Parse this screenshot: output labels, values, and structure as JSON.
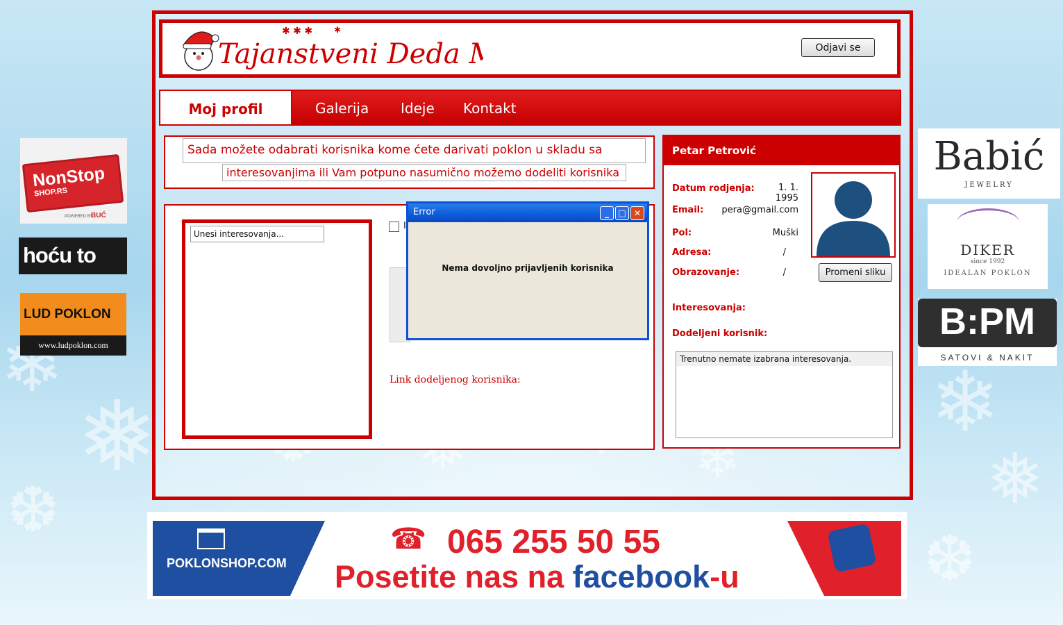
{
  "header": {
    "title": "Tajanstveni Deda Mraz",
    "logout_label": "Odjavi se"
  },
  "nav": {
    "items": [
      {
        "label": "Moj profil"
      },
      {
        "label": "Galerija"
      },
      {
        "label": "Ideje"
      },
      {
        "label": "Kontakt"
      }
    ]
  },
  "info": {
    "line1": "Sada možete odabrati korisnika kome ćete darivati poklon u skladu sa",
    "line2": "interesovanjima ili Vam potpuno nasumično možemo dodeliti korisnika"
  },
  "interests": {
    "input_value": "Unesi interesovanja...",
    "checkbox_label": "I",
    "link_label": "Link dodeljenog korisnika:"
  },
  "dialog": {
    "title": "Error",
    "message": "Nema dovoljno prijavljenih korisnika"
  },
  "profile": {
    "name": "Petar Petrović",
    "fields": [
      {
        "label": "Datum rodjenja:",
        "value": "1. 1. 1995"
      },
      {
        "label": "Email:",
        "value": "pera@gmail.com"
      },
      {
        "label": "Pol:",
        "value": "Muški"
      },
      {
        "label": "Adresa:",
        "value": "/"
      },
      {
        "label": "Obrazovanje:",
        "value": "/"
      }
    ],
    "change_photo_label": "Promeni sliku",
    "interests_label": "Interesovanja:",
    "assigned_label": "Dodeljeni korisnik:",
    "interests_list_text": "Trenutno nemate izabrana interesovanja."
  },
  "ads": {
    "nonstop": {
      "line1": "NonStop",
      "line2": "SHOP.RS",
      "small": "POWERED BY",
      "brand": "BUĆ"
    },
    "hocuto": {
      "text": "hoću to"
    },
    "ludpoklon": {
      "text": "LUD POKLON",
      "url": "www.ludpoklon.com"
    },
    "babic": {
      "name": "Babić",
      "sub": "JEWELRY"
    },
    "diker": {
      "name": "DIKER",
      "since": "since 1992",
      "sub": "IDEALAN POKLON"
    },
    "bpm": {
      "name": "B:PM",
      "sub": "SATOVI & NAKIT"
    },
    "poklonshop": {
      "brand": "POKLONSHOP.COM",
      "phone": "065 255 50 55",
      "cta": "Posetite nas na",
      "fb": "facebook",
      "fb_suffix": "-u"
    }
  },
  "colors": {
    "accent": "#cc0000",
    "dialog_blue": "#0a52d6",
    "avatar": "#1d4f7f"
  }
}
